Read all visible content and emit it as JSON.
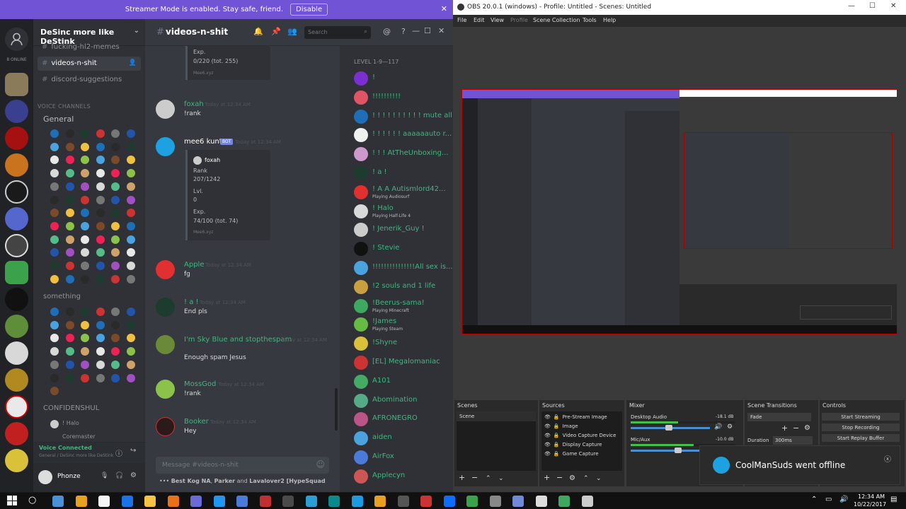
{
  "streamer_bar": {
    "text": "Streamer Mode is enabled. Stay safe, friend.",
    "disable": "Disable",
    "close": "✕"
  },
  "guilds": {
    "online": "8 ONLINE"
  },
  "server": {
    "name": "DeSinc more like DeStink"
  },
  "channels": {
    "text": [
      {
        "name": "fucking-hl2-memes"
      },
      {
        "name": "videos-n-shit"
      },
      {
        "name": "discord-suggestions"
      }
    ],
    "voice_category": "VOICE CHANNELS",
    "voice": [
      {
        "name": "General"
      },
      {
        "name": "something"
      },
      {
        "name": "CONFIDENSHUL"
      }
    ],
    "confidenshul_users": [
      "! Halo",
      "Coremaster"
    ]
  },
  "voice_status": {
    "title": "Voice Connected",
    "sub": "General / DeSinc more like DeStink"
  },
  "user": {
    "name": "Phonze"
  },
  "chat": {
    "channel": "videos-n-shit",
    "search_placeholder": "Search",
    "input_placeholder": "Message #videos-n-shit",
    "typing": {
      "a": "Best Kog NA",
      "b": "Parker",
      "c": "Lavalover2 [HypeSquad",
      "and": "and",
      "comma": ","
    },
    "top_embed": {
      "label": "Exp.",
      "value": "0/220 (tot. 255)",
      "footer": "Mee6.xyz"
    },
    "messages": [
      {
        "author": "foxah",
        "time": "Today at 12:34 AM",
        "text": "!rank",
        "color": "#43b581"
      },
      {
        "author": "mee6 kunt",
        "bot": "BOT",
        "time": "Today at 12:34 AM",
        "color": "#ffffff",
        "embed": {
          "name": "foxah",
          "rank_label": "Rank",
          "rank": "207/1242",
          "lvl_label": "Lvl.",
          "lvl": "0",
          "exp_label": "Exp.",
          "exp": "74/100 (tot. 74)",
          "footer": "Mee6.xyz"
        }
      },
      {
        "author": "Apple",
        "time": "Today at 12:34 AM",
        "text": "fg",
        "color": "#43b581"
      },
      {
        "author": "! a !",
        "time": "Today at 12:34 AM",
        "text": "End pls",
        "color": "#43b581"
      },
      {
        "author": "I'm Sky Blue and stopthespam",
        "time": "Today at 12:34 AM",
        "text": "Enough spam Jesus",
        "color": "#43b581"
      },
      {
        "author": "MossGod",
        "time": "Today at 12:34 AM",
        "text": "!rank",
        "color": "#43b581"
      },
      {
        "author": "Booker",
        "time": "Today at 12:34 AM",
        "text": "Hey",
        "color": "#43b581"
      }
    ]
  },
  "members": {
    "header": "LEVEL 1-9—117",
    "list": [
      {
        "name": "!",
        "activity": ""
      },
      {
        "name": "!!!!!!!!!!",
        "activity": ""
      },
      {
        "name": "! ! ! ! ! ! ! ! ! ! mute all ...",
        "activity": ""
      },
      {
        "name": "! ! ! ! ! ! aaaaaauto r...",
        "activity": ""
      },
      {
        "name": "! ! ! AtTheUnboxing...",
        "activity": ""
      },
      {
        "name": "! a !",
        "activity": ""
      },
      {
        "name": "! A A Autismlord42...",
        "activity": "Playing Audiosurf"
      },
      {
        "name": "! Halo",
        "activity": "Playing Half-Life 4"
      },
      {
        "name": "! Jenerik_Guy !",
        "activity": ""
      },
      {
        "name": "! Stevie",
        "activity": ""
      },
      {
        "name": "!!!!!!!!!!!!!!!All sex is...",
        "activity": ""
      },
      {
        "name": "!2 souls and 1 life",
        "activity": ""
      },
      {
        "name": "!Beerus-sama!",
        "activity": "Playing Minecraft"
      },
      {
        "name": "!James",
        "activity": "Playing Steam"
      },
      {
        "name": "!Shyne",
        "activity": ""
      },
      {
        "name": "[EL] Megalomaniac",
        "activity": ""
      },
      {
        "name": "A101",
        "activity": ""
      },
      {
        "name": "Abomination",
        "activity": ""
      },
      {
        "name": "AFRONEGRO",
        "activity": ""
      },
      {
        "name": "aiden",
        "activity": ""
      },
      {
        "name": "AirFox",
        "activity": ""
      },
      {
        "name": "Applecyn",
        "activity": ""
      }
    ]
  },
  "obs": {
    "title": "OBS 20.0.1 (windows) - Profile: Untitled - Scenes: Untitled",
    "menu": [
      "File",
      "Edit",
      "View",
      "Profile",
      "Scene Collection",
      "Tools",
      "Help"
    ],
    "docks": {
      "scenes": "Scenes",
      "sources": "Sources",
      "mixer": "Mixer",
      "transitions": "Scene Transitions",
      "controls": "Controls"
    },
    "scene_item": "Scene",
    "sources": [
      "Pre-Stream Image",
      "Image",
      "Video Capture Device",
      "Display Capture",
      "Game Capture"
    ],
    "mixer": [
      {
        "name": "Desktop Audio",
        "db": "-18.1 dB",
        "level": 0.45
      },
      {
        "name": "Mic/Aux",
        "db": "-10.0 dB",
        "level": 0.6
      }
    ],
    "transition": "Fade",
    "duration_label": "Duration",
    "duration": "300ms",
    "controls": [
      "Start Streaming",
      "Stop Recording",
      "Start Replay Buffer"
    ]
  },
  "toast": {
    "text": "CoolManSuds went offline"
  },
  "taskbar": {
    "time": "12:34 AM",
    "date": "10/22/2017"
  },
  "colors": {
    "discord_bg": "#36393f",
    "streamer_purple": "#7154d6",
    "online_green": "#43b581",
    "obs_bg": "#3a3a3a"
  }
}
